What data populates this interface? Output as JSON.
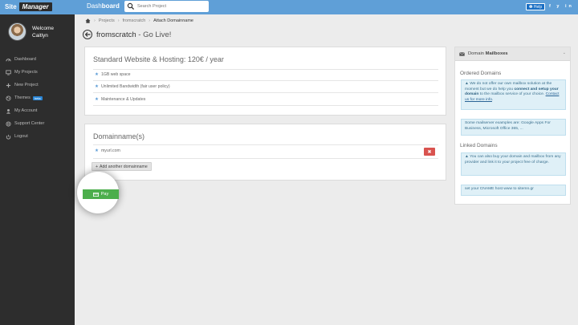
{
  "topbar": {
    "logo_part1": "Site",
    "logo_part2": "Manager",
    "dashboard_light": "Dash",
    "dashboard_bold": "board",
    "search_placeholder": "Search Project",
    "help_label": "Help",
    "social": "f y in"
  },
  "user": {
    "welcome": "Welcome",
    "name": "Caitlyn"
  },
  "sidebar": {
    "items": [
      {
        "label": "Dashboard",
        "icon": "dashboard-icon"
      },
      {
        "label": "My Projects",
        "icon": "monitor-icon"
      },
      {
        "label": "New Project",
        "icon": "plus-icon"
      },
      {
        "label": "Themes",
        "icon": "palette-icon",
        "badge": "beta"
      },
      {
        "label": "My Account",
        "icon": "user-icon"
      },
      {
        "label": "Support Center",
        "icon": "support-icon"
      },
      {
        "label": "Logout",
        "icon": "power-icon"
      }
    ]
  },
  "breadcrumb": {
    "items": [
      "Projects",
      "fromscratch",
      "Attach Domainname"
    ]
  },
  "page": {
    "title": "fromscratch",
    "subtitle": " - Go Live!"
  },
  "plan": {
    "title": "Standard Website & Hosting: 120€ / year",
    "features": [
      "1GB web space",
      "Unlimited Bandwidth (fair user policy)",
      "Maintenance & Updates"
    ]
  },
  "domains": {
    "title": "Domainname(s)",
    "entries": [
      "myurl.com"
    ],
    "add_label": "Add another domainname",
    "delete_symbol": "✖"
  },
  "pay": {
    "label": "Pay"
  },
  "mailboxes": {
    "header_light": "Domain",
    "header_bold": "Mailboxes",
    "ordered_title": "Ordered Domains",
    "ordered_info_1": "We do not offer our own mailbox solution at the moment but we do help you ",
    "ordered_info_bold": "connect and setup your domain",
    "ordered_info_2": " to the mailbox service of your choice. ",
    "ordered_info_link": "Contact us for more info",
    "ordered_info_end": ".",
    "examples": "Some mailserver examples are: Google Apps For Business, Microsoft Office 365, ...",
    "linked_title": "Linked Domains",
    "linked_info": "You can also buy your domain and mailbox from any provider and link it to your project free of charge.",
    "cname": "set your CNAME host www to sitemn.gr"
  },
  "colors": {
    "topbar": "#5f9fd7",
    "sidebar": "#2d2d2d",
    "pay": "#4cae4c",
    "delete": "#d9534f",
    "info_bg": "#dff0f7"
  }
}
